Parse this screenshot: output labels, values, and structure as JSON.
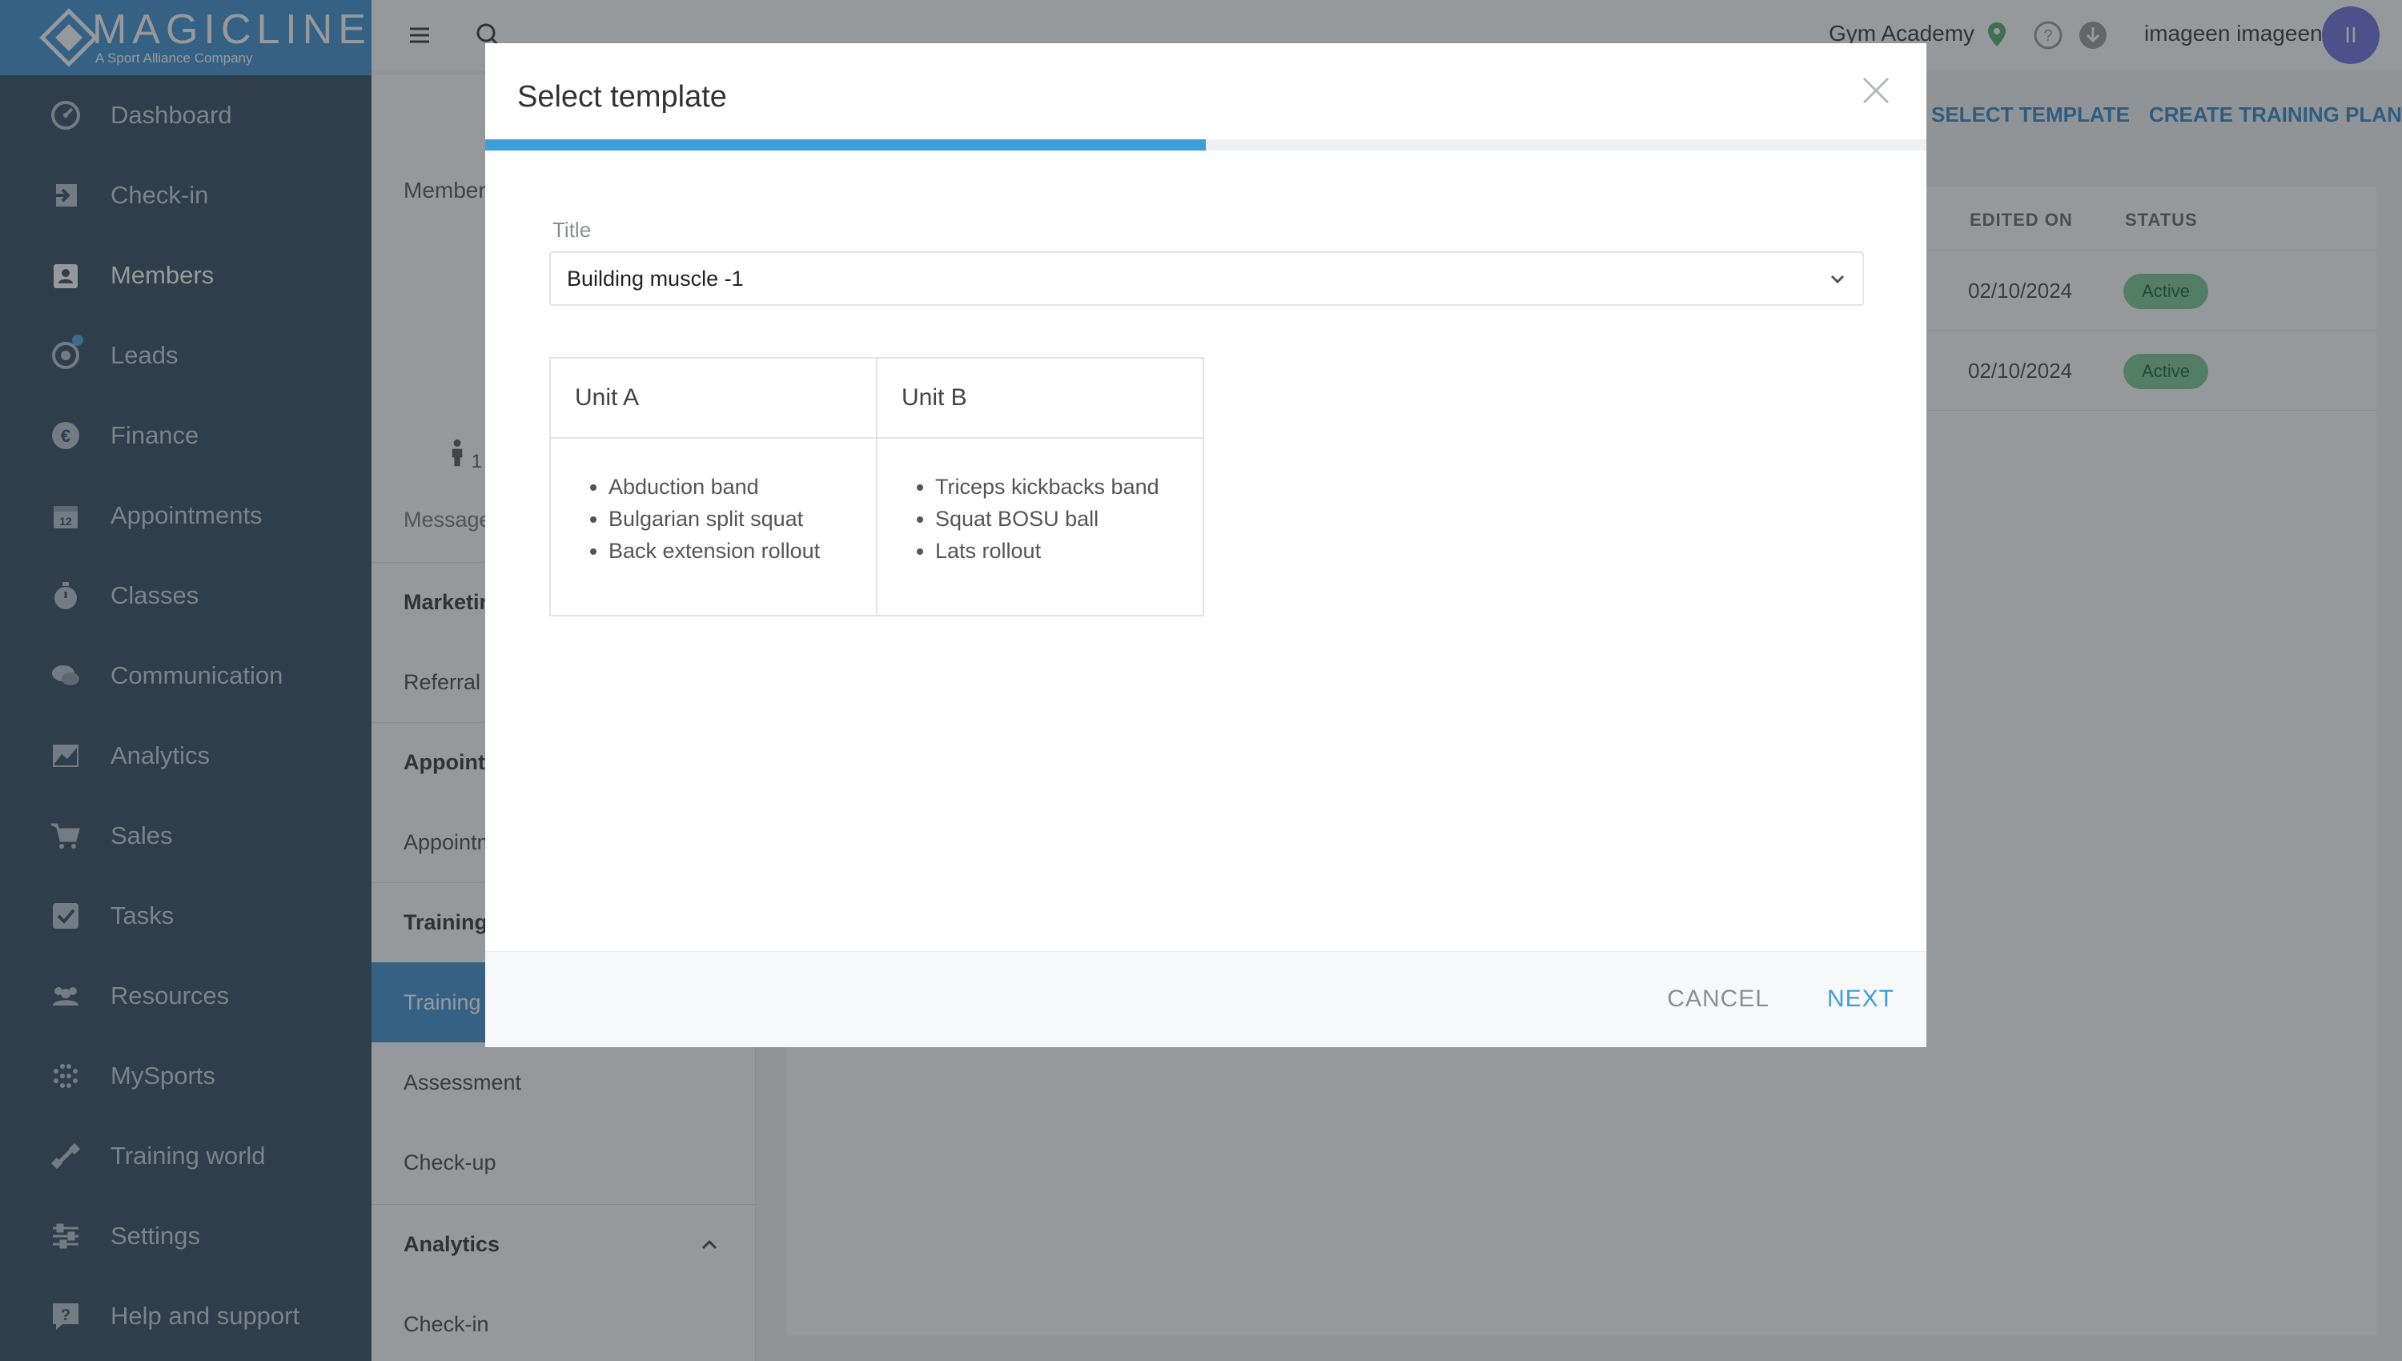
{
  "brand": {
    "name": "MAGICLINE",
    "tagline": "A Sport Alliance Company"
  },
  "sidebar": {
    "items": [
      {
        "label": "Dashboard",
        "icon": "dashboard-icon"
      },
      {
        "label": "Check-in",
        "icon": "check-in-icon"
      },
      {
        "label": "Members",
        "icon": "members-icon",
        "active": true
      },
      {
        "label": "Leads",
        "icon": "leads-icon"
      },
      {
        "label": "Finance",
        "icon": "finance-icon"
      },
      {
        "label": "Appointments",
        "icon": "calendar-icon"
      },
      {
        "label": "Classes",
        "icon": "stopwatch-icon"
      },
      {
        "label": "Communication",
        "icon": "chat-icon"
      },
      {
        "label": "Analytics",
        "icon": "chart-icon"
      },
      {
        "label": "Sales",
        "icon": "cart-icon"
      },
      {
        "label": "Tasks",
        "icon": "checkbox-icon"
      },
      {
        "label": "Resources",
        "icon": "people-icon"
      },
      {
        "label": "MySports",
        "icon": "dots-grid-icon"
      },
      {
        "label": "Training world",
        "icon": "dumbbell-icon"
      },
      {
        "label": "Settings",
        "icon": "sliders-icon"
      },
      {
        "label": "Help and support",
        "icon": "help-icon"
      }
    ]
  },
  "topbar": {
    "studio": "Gym Academy",
    "user": "imageen imageen",
    "avatar_initials": "II"
  },
  "subnav": {
    "breadcrumb": "Members",
    "profile_partial": "1",
    "partial_item": "Message",
    "groups": [
      {
        "head": "Marketing",
        "items": [
          "Referral p"
        ]
      },
      {
        "head": "Appointm",
        "items": [
          "Appointm"
        ]
      },
      {
        "head": "Training",
        "items": [
          "Training",
          "Assessment",
          "Check-up"
        ],
        "active_index": 0
      },
      {
        "head": "Analytics",
        "items": [
          "Check-in"
        ]
      }
    ]
  },
  "main": {
    "actions": {
      "select_template": "SELECT TEMPLATE",
      "create_training_plan": "CREATE TRAINING PLAN"
    },
    "columns": {
      "edited_on": "EDITED ON",
      "status": "STATUS"
    },
    "rows": [
      {
        "edited_on": "02/10/2024",
        "status": "Active"
      },
      {
        "edited_on": "02/10/2024",
        "status": "Active"
      }
    ]
  },
  "modal": {
    "title": "Select template",
    "progress": 0.5,
    "field_label": "Title",
    "selected_template": "Building muscle -1",
    "units": [
      {
        "name": "Unit A",
        "exercises": [
          "Abduction band",
          "Bulgarian split squat",
          "Back extension rollout"
        ]
      },
      {
        "name": "Unit B",
        "exercises": [
          "Triceps kickbacks band",
          "Squat BOSU ball",
          "Lats rollout"
        ]
      }
    ],
    "cancel_label": "CANCEL",
    "next_label": "NEXT"
  },
  "colors": {
    "sidebar": "#33475a",
    "brand_blue": "#3c8fd0",
    "accent": "#3c9fd9",
    "active_badge": "#7bc693"
  }
}
